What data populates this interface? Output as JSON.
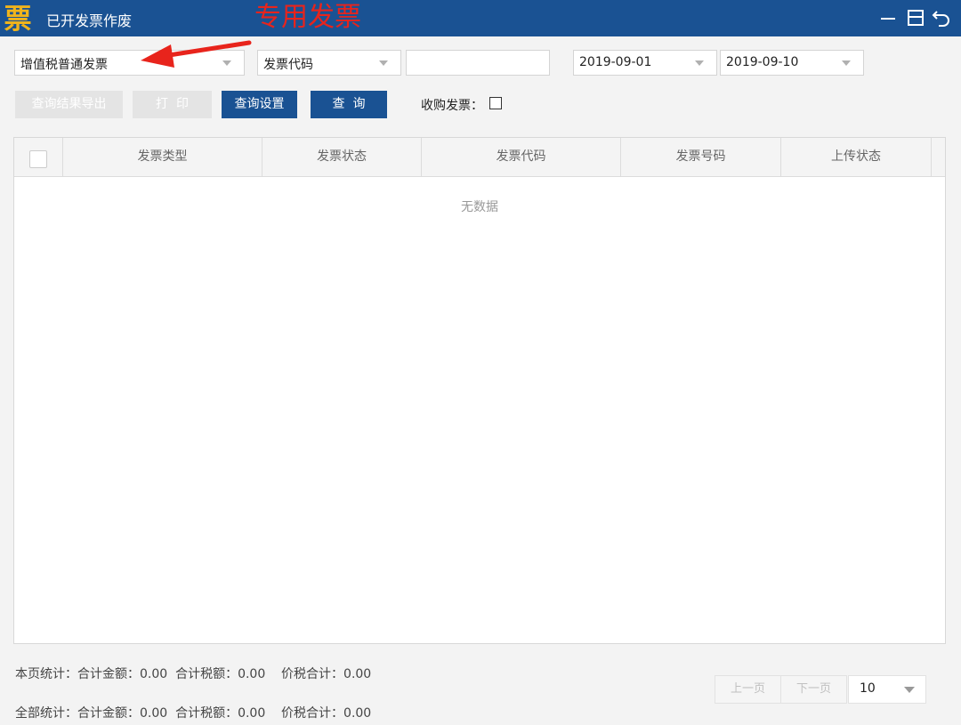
{
  "titlebar": {
    "logo_glyph": "票",
    "title": "已开发票作废",
    "annotation": "专用发票",
    "annotation_color": "#e8241c",
    "brand_color": "#1a5293",
    "controls": [
      "minimize-icon",
      "restore-icon",
      "back-icon"
    ]
  },
  "filters": {
    "invoice_type": "增值税普通发票",
    "search_field": "发票代码",
    "search_value": "",
    "date_start": "2019-09-01",
    "date_end": "2019-09-10"
  },
  "toolbar": {
    "export_label": "查询结果导出",
    "print_label": "打  印",
    "settings_label": "查询设置",
    "query_label": "查  询",
    "purchase_invoice_label": "收购发票：",
    "purchase_invoice_checked": false
  },
  "table": {
    "columns": [
      "发票类型",
      "发票状态",
      "发票代码",
      "发票号码",
      "上传状态"
    ],
    "rows": [],
    "empty_text": "无数据"
  },
  "summary": {
    "page_stats": "本页统计：合计金额：0.00  合计税额：0.00    价税合计：0.00",
    "all_stats": "全部统计：合计金额：0.00  合计税额：0.00    价税合计：0.00"
  },
  "pager": {
    "prev_label": "上一页",
    "next_label": "下一页",
    "page_size": "10"
  }
}
